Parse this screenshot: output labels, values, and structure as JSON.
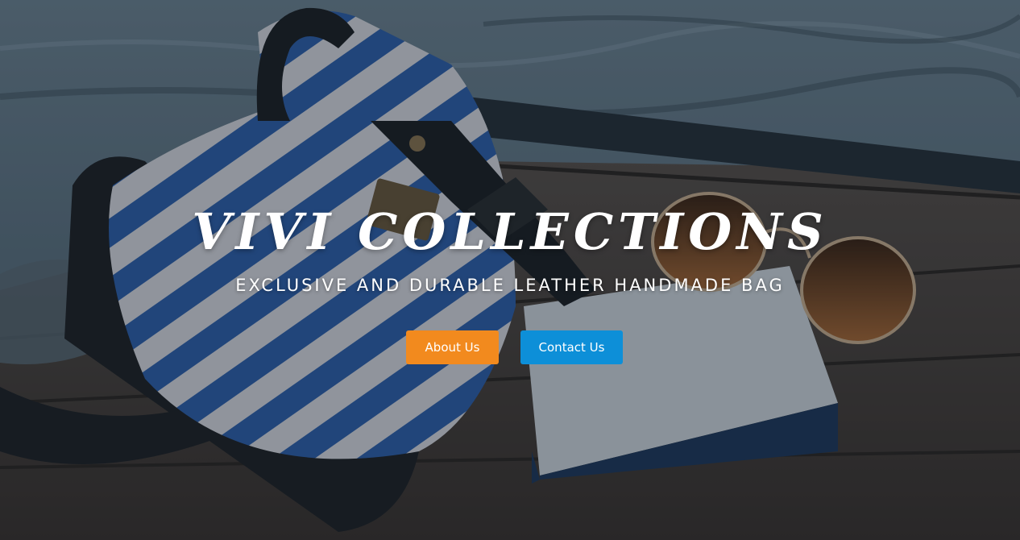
{
  "hero": {
    "title": "VIVI COLLECTIONS",
    "subtitle": "EXCLUSIVE AND DURABLE LEATHER HANDMADE BAG",
    "background_image": "bag-book-sunglasses-on-dock-photo"
  },
  "buttons": {
    "about_label": "About Us",
    "contact_label": "Contact Us"
  },
  "colors": {
    "about_button": "#f28a1e",
    "contact_button": "#0d8fd8",
    "text": "#ffffff"
  }
}
